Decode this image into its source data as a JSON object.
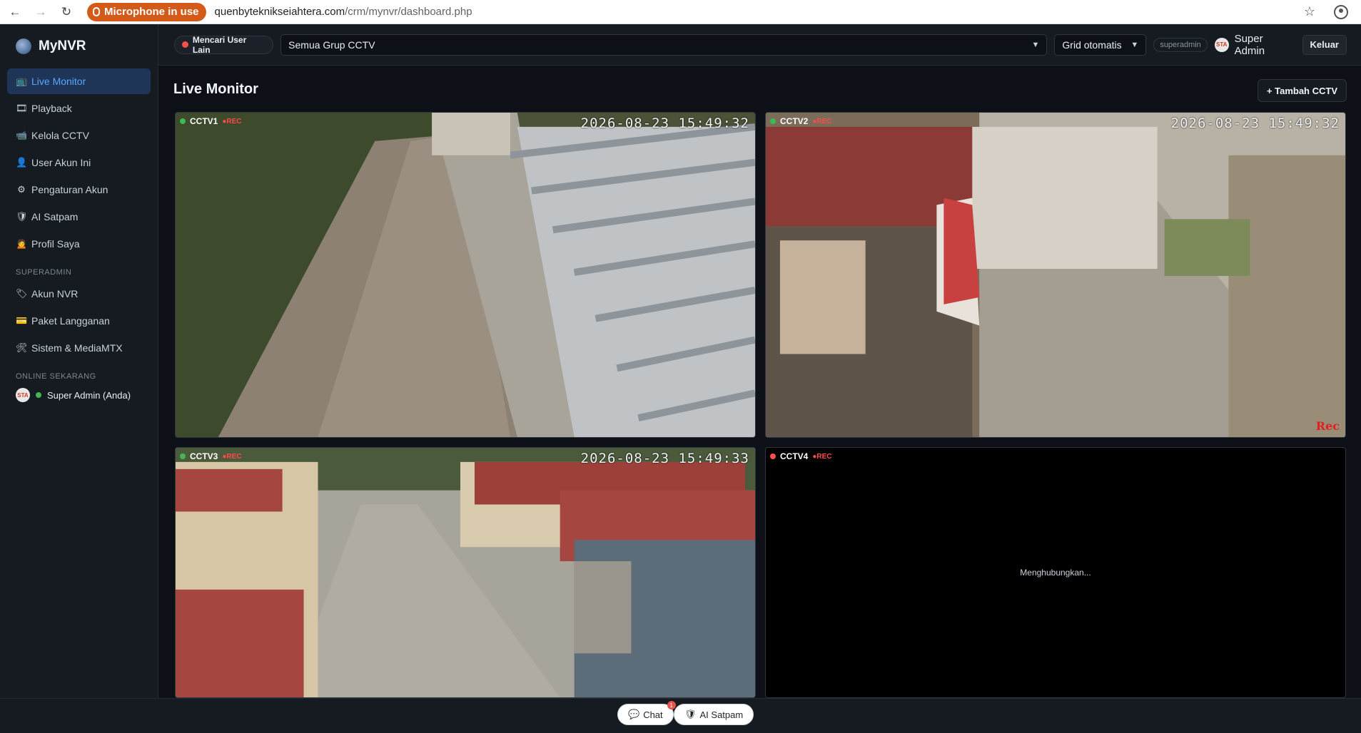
{
  "browser": {
    "mic_label": "Microphone in use",
    "url_domain": "quenbyteknikseiahtera.com",
    "url_path": "/crm/mynvr/dashboard.php"
  },
  "sidebar": {
    "brand": "MyNVR",
    "items": [
      {
        "icon": "📺",
        "label": "Live Monitor",
        "active": true
      },
      {
        "icon": "🎞",
        "label": "Playback"
      },
      {
        "icon": "📹",
        "label": "Kelola CCTV"
      },
      {
        "icon": "👤",
        "label": "User Akun Ini"
      },
      {
        "icon": "⚙",
        "label": "Pengaturan Akun"
      },
      {
        "icon": "🛡",
        "label": "AI Satpam"
      },
      {
        "icon": "🙍",
        "label": "Profil Saya"
      }
    ],
    "section_superadmin": "SUPERADMIN",
    "admin_items": [
      {
        "icon": "🏷",
        "label": "Akun NVR"
      },
      {
        "icon": "💳",
        "label": "Paket Langganan"
      },
      {
        "icon": "🛠",
        "label": "Sistem & MediaMTX"
      }
    ],
    "section_online": "ONLINE SEKARANG",
    "online_user": "Super Admin (Anda)",
    "avatar_text": "STA"
  },
  "topbar": {
    "search_user_label": "Mencari User Lain",
    "group_select": "Semua Grup CCTV",
    "grid_select": "Grid otomatis",
    "role": "superadmin",
    "user_name": "Super Admin",
    "logout": "Keluar"
  },
  "main": {
    "title": "Live Monitor",
    "add_button": "+ Tambah CCTV",
    "cameras": [
      {
        "name": "CCTV1",
        "rec": "●REC",
        "timestamp": "2026-08-23 15:49:32",
        "status_color": "#3fb950"
      },
      {
        "name": "CCTV2",
        "rec": "●REC",
        "timestamp": "2026-08-23 15:49:32",
        "status_color": "#3fb950",
        "rec_corner": "Rec"
      },
      {
        "name": "CCTV3",
        "rec": "●REC",
        "timestamp": "2026-08-23 15:49:33",
        "status_color": "#3fb950"
      },
      {
        "name": "CCTV4",
        "rec": "●REC",
        "status_color": "#f85149",
        "status_text": "Menghubungkan..."
      }
    ]
  },
  "floating": {
    "chat": "Chat",
    "chat_badge": "1",
    "ai_satpam": "AI Satpam"
  }
}
